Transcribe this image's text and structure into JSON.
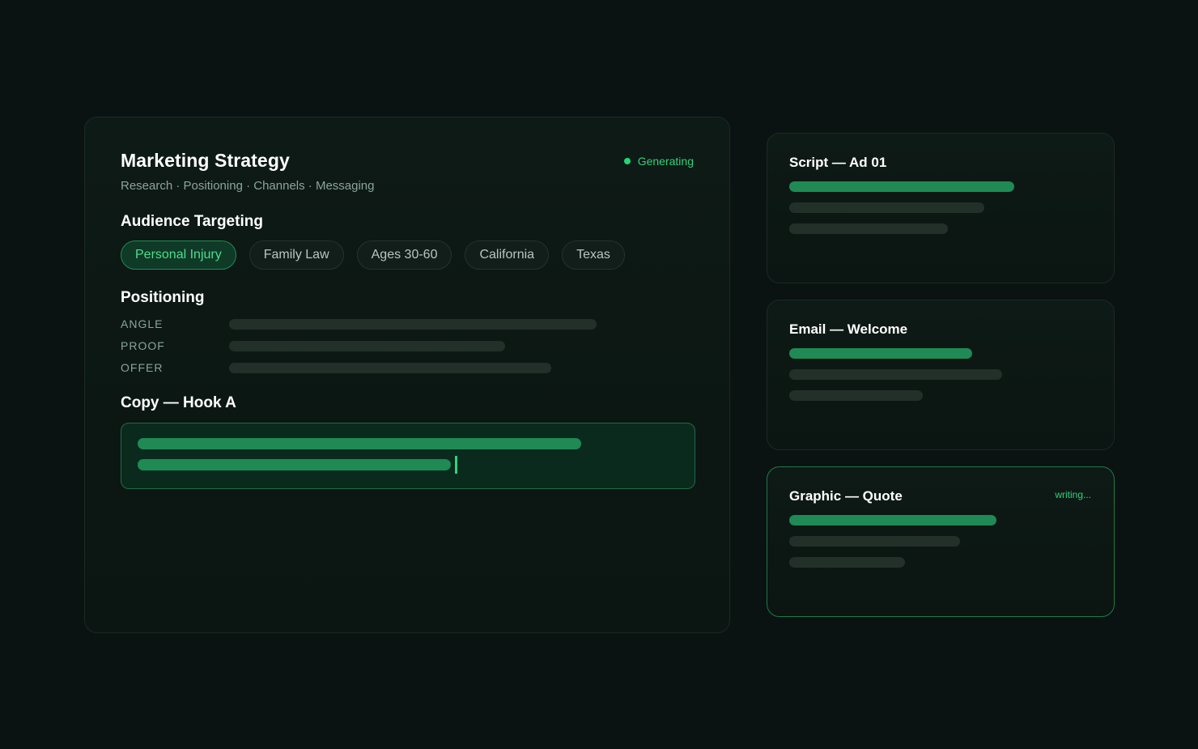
{
  "strategy": {
    "title": "Marketing Strategy",
    "status": "Generating",
    "breadcrumb": "Research · Positioning · Channels · Messaging",
    "audience_heading": "Audience Targeting",
    "chips": [
      "Personal Injury",
      "Family Law",
      "Ages 30-60",
      "California",
      "Texas"
    ],
    "active_chip": "Personal Injury",
    "positioning_heading": "Positioning",
    "positioning_rows": [
      "ANGLE",
      "PROOF",
      "OFFER"
    ],
    "copy_heading": "Copy — Hook A"
  },
  "assets": [
    {
      "title": "Script — Ad 01",
      "status": ""
    },
    {
      "title": "Email — Welcome",
      "status": ""
    },
    {
      "title": "Graphic — Quote",
      "status": "writing..."
    }
  ],
  "colors": {
    "background": "#0a1311",
    "accent": "#2ed47a",
    "bar_green": "#1f8a53",
    "bar_placeholder": "#233029"
  }
}
